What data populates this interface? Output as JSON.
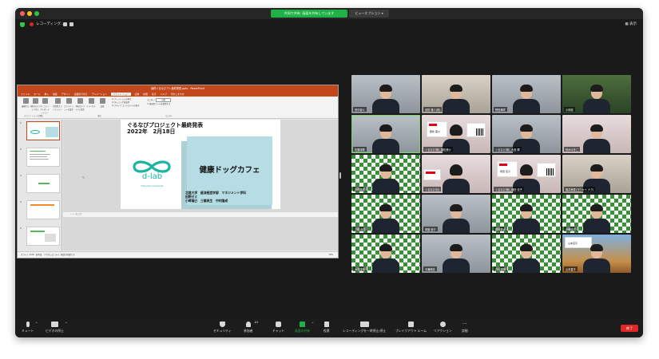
{
  "banner": {
    "text": "共同で共有: 画面を共有しています",
    "view_options": "ビューオプション ▾"
  },
  "topbar": {
    "recording": "レコーディング...",
    "view": "表示"
  },
  "ppt": {
    "title": "最終ぐるなびプレ最終発表.pptx - PowerPoint",
    "tabs": [
      "ファイル",
      "ホーム",
      "挿入",
      "描画",
      "デザイン",
      "画面切り替え",
      "アニメーション",
      "スライド ショー",
      "記録",
      "校閲",
      "表示",
      "ヘルプ",
      "何をしますか"
    ],
    "active_tab": "スライド ショー",
    "ribbon_buttons": [
      "最初から",
      "現在のスライドから",
      "オンラインプレゼンテーション",
      "目的別スライドショー",
      "スライドショーの設定",
      "非表示スライドに設定",
      "リハーサル",
      "記録"
    ],
    "ribbon_checks": [
      "ナレーションの再生",
      "タイミングを使用",
      "メディア コントロールの表示"
    ],
    "monitor_label": "モニター:",
    "monitor_value": "自動",
    "presenter_view": "発表者ツールを使用する",
    "group_labels": [
      "スライド ショーの開始",
      "設定",
      "モニター"
    ],
    "thumb_numbers": [
      "1",
      "2",
      "3",
      "4",
      "5"
    ],
    "notes_placeholder": "ノートを入力",
    "status": "スライド 1/26　日本語　アクセシビリティ: 検討が必要です",
    "zoom": "79%",
    "slide": {
      "title_line1": "ぐるなびプロジェクト最終発表",
      "title_line2": "2022年　2月18日",
      "box_text": "健康ドッグカフェ",
      "logo_text": "d-lab",
      "logo_sub": "Hokudai University",
      "footer_line1": "北陸大学　経済経営学部　マネジメント学科",
      "footer_line2": "田院ゼミ",
      "footer_line3": "小﨑瑞己　三橋尚生　中村隆成"
    }
  },
  "participants": [
    {
      "name": "田中健斗",
      "bg": "office"
    },
    {
      "name": "武田 雅人(株)",
      "bg": "room"
    },
    {
      "name": "野田美咲",
      "bg": "office"
    },
    {
      "name": "小林健",
      "bg": "forest"
    },
    {
      "name": "佐藤康雄",
      "bg": "office"
    },
    {
      "name": "ぐるなび(株)_藤松美沙",
      "bg": "card",
      "card_name": "藤松 美沙"
    },
    {
      "name": "ぐるなび(株)_大宮 輝",
      "bg": "office"
    },
    {
      "name": "鈴木ゆきこ",
      "bg": "pinkroom"
    },
    {
      "name": "中村隆成",
      "bg": "check"
    },
    {
      "name": "ぐるなび(社)",
      "bg": "card2"
    },
    {
      "name": "ぐるなび(株)_増田 佳子",
      "bg": "card",
      "card_name": "増田 佳子"
    },
    {
      "name": "藤井美香(ヨウキイ ナク)",
      "bg": "room"
    },
    {
      "name": "三橋 尚生",
      "bg": "check"
    },
    {
      "name": "斉藤 健介",
      "bg": "office"
    },
    {
      "name": "橋本勇太",
      "bg": "check"
    },
    {
      "name": "小﨑瑞己",
      "bg": "check"
    },
    {
      "name": "大沼康佑",
      "bg": "check"
    },
    {
      "name": "中瀬萌花",
      "bg": "office"
    },
    {
      "name": "井山雄翔",
      "bg": "check"
    },
    {
      "name": "山本直平",
      "bg": "shrine",
      "card_name": "山本直平"
    }
  ],
  "toolbar": {
    "mute": "ミュート",
    "video": "ビデオの停止",
    "security": "セキュリティ",
    "participants": "参加者",
    "participants_count": "22",
    "chat": "チャット",
    "share": "画面の共有",
    "polls": "投票",
    "record": "レコーディングを一時停止/停止",
    "breakout": "ブレイクアウト ルーム",
    "reactions": "リアクション",
    "more": "詳細",
    "end": "終了"
  },
  "colors": {
    "accent_green": "#1fb145",
    "ppt_orange": "#c4471c",
    "end_red": "#e02828"
  }
}
